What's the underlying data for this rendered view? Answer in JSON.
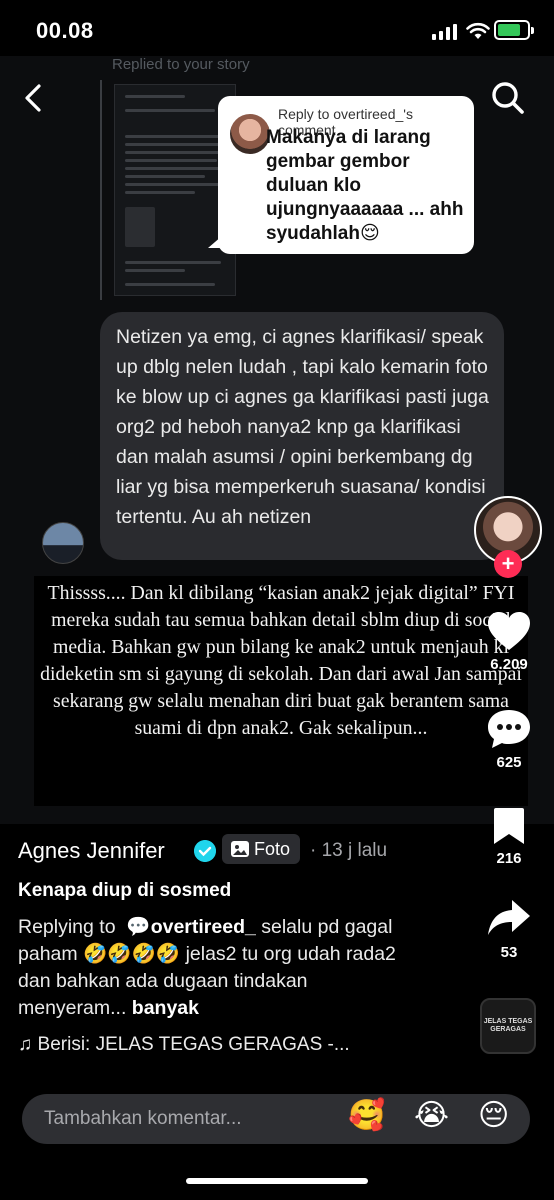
{
  "status_bar": {
    "time": "00.08"
  },
  "story": {
    "replied_label": "Replied to your story",
    "reply_card": {
      "reply_to": "Reply to overtireed_'s comment",
      "text": "Makanya di larang gembar gembor duluan klo ujungnyaaaaaa ... ahh syudahlah😌"
    },
    "bubble_text": "Netizen ya emg, ci agnes klarifikasi/ speak up dblg nelen ludah , tapi kalo kemarin foto ke blow up ci agnes ga klarifikasi pasti juga org2 pd heboh nanya2 knp ga klarifikasi dan malah asumsi / opini berkembang dg liar yg bisa memperkeruh suasana/ kondisi tertentu. Au ah netizen",
    "caption": "Thissss.... Dan kl dibilang “kasian anak2 jejak digital” FYI mereka sudah tau semua bahkan detail sblm diup di social media. Bahkan gw pun bilang ke anak2 untuk menjauh kl dideketin sm si gayung di sekolah. Dan dari awal Jan sampai sekarang gw selalu menahan diri buat gak berantem sama suami di dpn anak2. Gak sekalipun..."
  },
  "rail": {
    "likes": "6.209",
    "comments": "625",
    "bookmarks": "216",
    "shares": "53"
  },
  "post": {
    "author": "Agnes Jennifer",
    "badge": "Foto",
    "time": "· 13 j lalu",
    "title": "Kenapa diup di sosmed",
    "replying_to": "Replying to",
    "mention": "overtireed_",
    "desc": " selalu pd gagal paham 🤣🤣🤣🤣 jelas2 tu org udah rada2 dan bahkan ada dugaan tindakan menyeram...",
    "more": "banyak",
    "music": "♫ Berisi: JELAS TEGAS GERAGAS -...",
    "disc_label": "JELAS TEGAS GERAGAS"
  },
  "comment_bar": {
    "placeholder": "Tambahkan komentar...",
    "emojis": [
      "🥰",
      "😭",
      "😔"
    ]
  },
  "colors": {
    "accent": "#fe2c55",
    "verified": "#20d5ec",
    "battery": "#34c759"
  }
}
